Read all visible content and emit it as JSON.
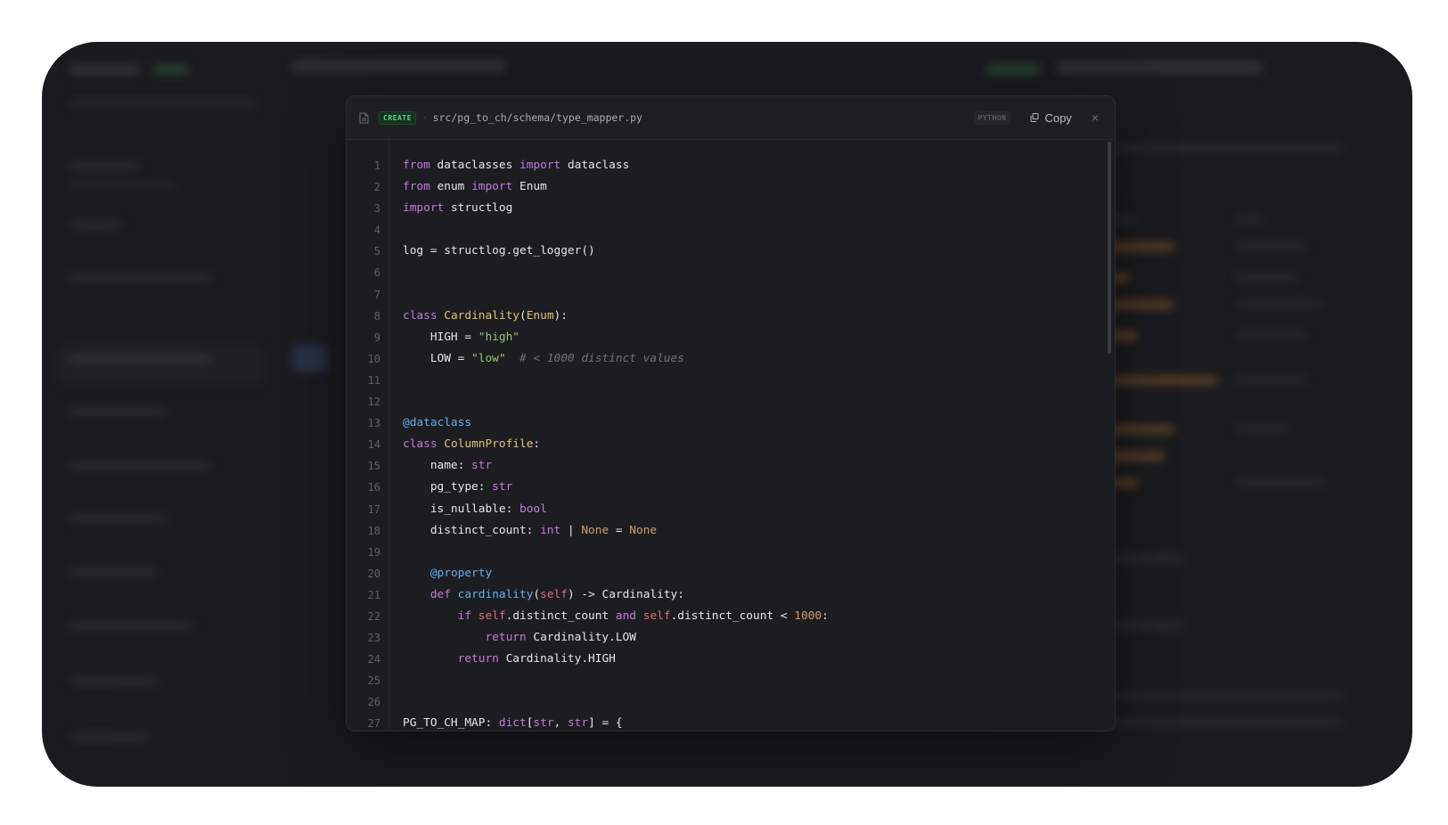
{
  "modal": {
    "action_badge": "CREATE",
    "separator": "·",
    "file_path": "src/pg_to_ch/schema/type_mapper.py",
    "language": "PYTHON",
    "copy_label": "Copy",
    "close_symbol": "×"
  },
  "code": {
    "line_numbers": [
      "1",
      "2",
      "3",
      "4",
      "5",
      "6",
      "7",
      "8",
      "9",
      "10",
      "11",
      "12",
      "13",
      "14",
      "15",
      "16",
      "17",
      "18",
      "19",
      "20",
      "21",
      "22",
      "23",
      "24",
      "25",
      "26",
      "27"
    ],
    "lines": [
      "from dataclasses import dataclass",
      "from enum import Enum",
      "import structlog",
      "",
      "log = structlog.get_logger()",
      "",
      "",
      "class Cardinality(Enum):",
      "    HIGH = \"high\"",
      "    LOW = \"low\"  # < 1000 distinct values",
      "",
      "",
      "@dataclass",
      "class ColumnProfile:",
      "    name: str",
      "    pg_type: str",
      "    is_nullable: bool",
      "    distinct_count: int | None = None",
      "",
      "    @property",
      "    def cardinality(self) -> Cardinality:",
      "        if self.distinct_count and self.distinct_count < 1000:",
      "            return Cardinality.LOW",
      "        return Cardinality.HIGH",
      "",
      "",
      "PG_TO_CH_MAP: dict[str, str] = {"
    ]
  },
  "colors": {
    "keyword": "#c678dd",
    "class_name": "#e5c07b",
    "string": "#98c379",
    "number": "#d19a66",
    "comment": "#6b717c",
    "decorator": "#61afef",
    "badge_green": "#4ade80"
  }
}
